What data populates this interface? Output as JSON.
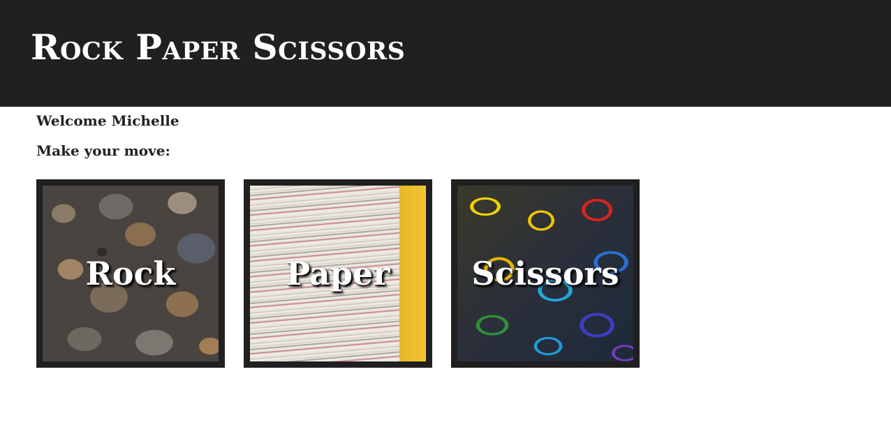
{
  "header": {
    "title": "Rock Paper Scissors",
    "background_color": "#202020"
  },
  "main": {
    "welcome_text": "Welcome Michelle",
    "prompt_text": "Make your move:",
    "choices": [
      {
        "label": "Rock",
        "image": "rock-pebbles-image"
      },
      {
        "label": "Paper",
        "image": "newspaper-stack-image"
      },
      {
        "label": "Scissors",
        "image": "colorful-scissors-image"
      }
    ]
  }
}
